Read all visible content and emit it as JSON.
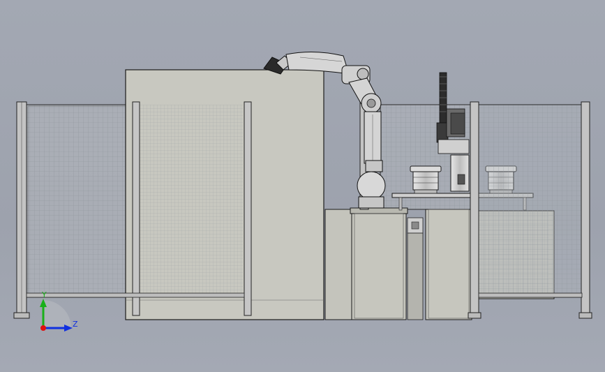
{
  "viewport": {
    "background": "#a0a5b0",
    "view_orientation": "front"
  },
  "triad": {
    "y_label": "Y",
    "z_label": "Z",
    "y_color": "#1ab01a",
    "z_color": "#1030e0",
    "x_color": "#e01010"
  },
  "colors": {
    "enclosure": "#c9c9c0",
    "panel": "#c4c4bc",
    "fence_frame": "#bcbcbc",
    "mesh": "#9aa0a6",
    "edge": "#202020",
    "robot": "#d4d4d4",
    "gripper": "#2a2a2a"
  },
  "components": [
    "fence-panel-left-1",
    "fence-panel-left-2",
    "main-enclosure",
    "industrial-robot-arm",
    "robot-base-pedestal",
    "control-cabinet",
    "right-cabinet",
    "work-table",
    "feeder-bowl-left",
    "feeder-bowl-right",
    "cylindrical-feeder",
    "vertical-gantry-gripper",
    "fence-panel-right-1",
    "fence-panel-right-2"
  ]
}
